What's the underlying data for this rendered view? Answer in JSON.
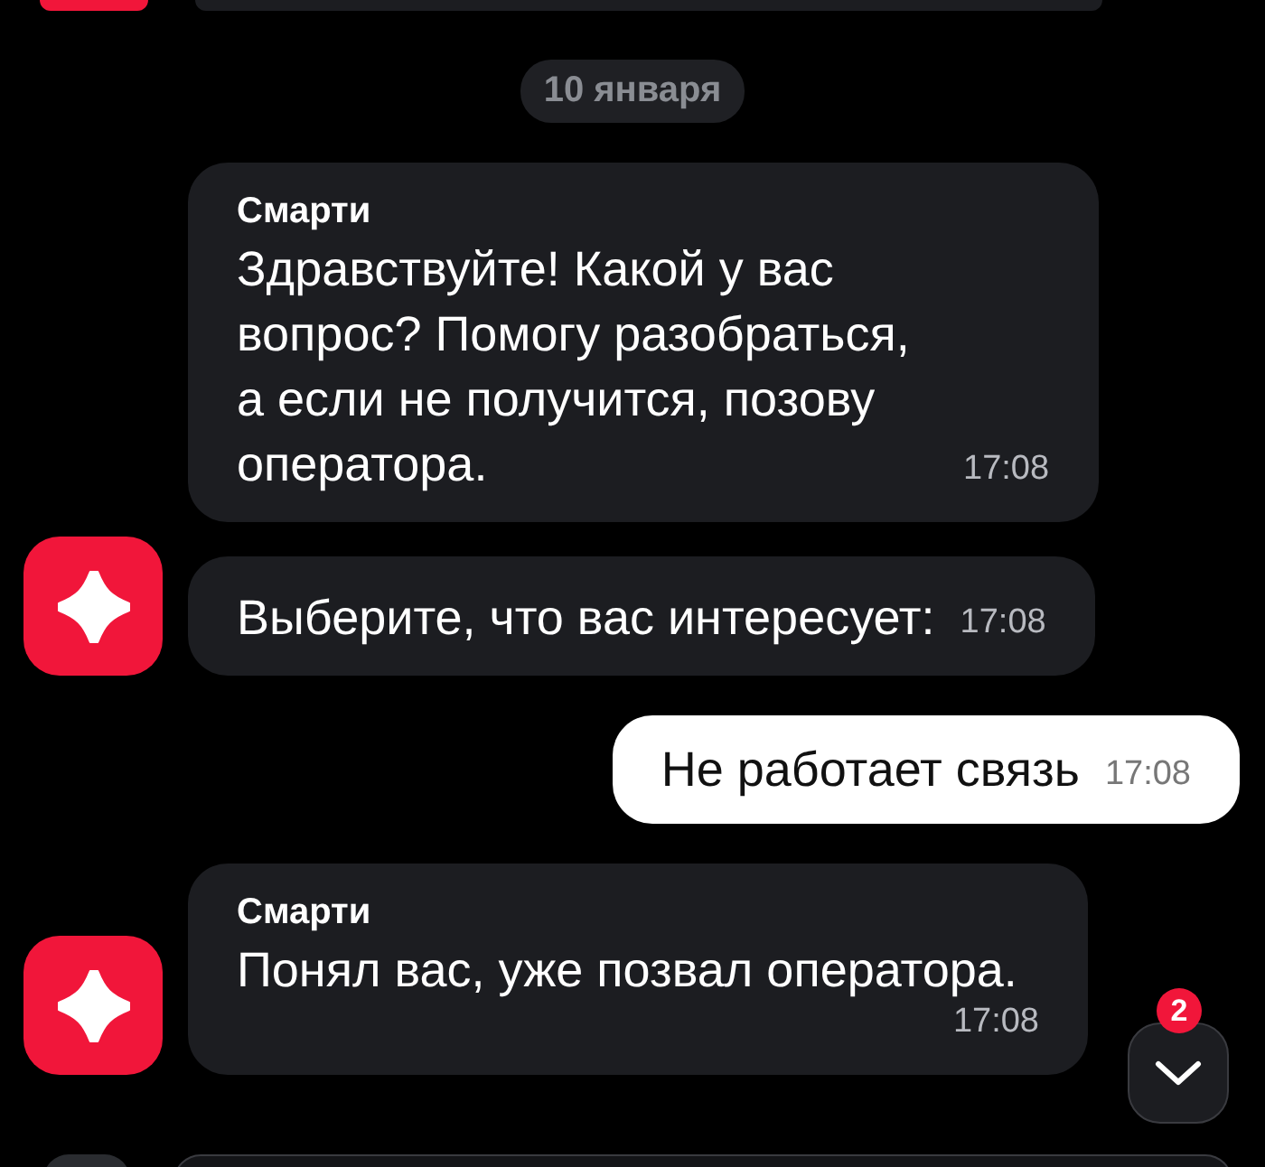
{
  "date_divider": "10 января",
  "messages": [
    {
      "kind": "incoming",
      "avatar": false,
      "sender": "Смарти",
      "text": "Здравствуйте! Какой у вас вопрос? Помогу разобраться, а если не получится, позову оператора.",
      "time": "17:08"
    },
    {
      "kind": "incoming",
      "avatar": true,
      "text": "Выберите, что вас интересует:",
      "time": "17:08"
    },
    {
      "kind": "outgoing",
      "text": "Не работает связь",
      "time": "17:08"
    },
    {
      "kind": "incoming",
      "avatar": true,
      "sender": "Смарти",
      "text": "Понял вас, уже позвал оператора.",
      "time": "17:08"
    }
  ],
  "scroll_down": {
    "badge": "2"
  }
}
